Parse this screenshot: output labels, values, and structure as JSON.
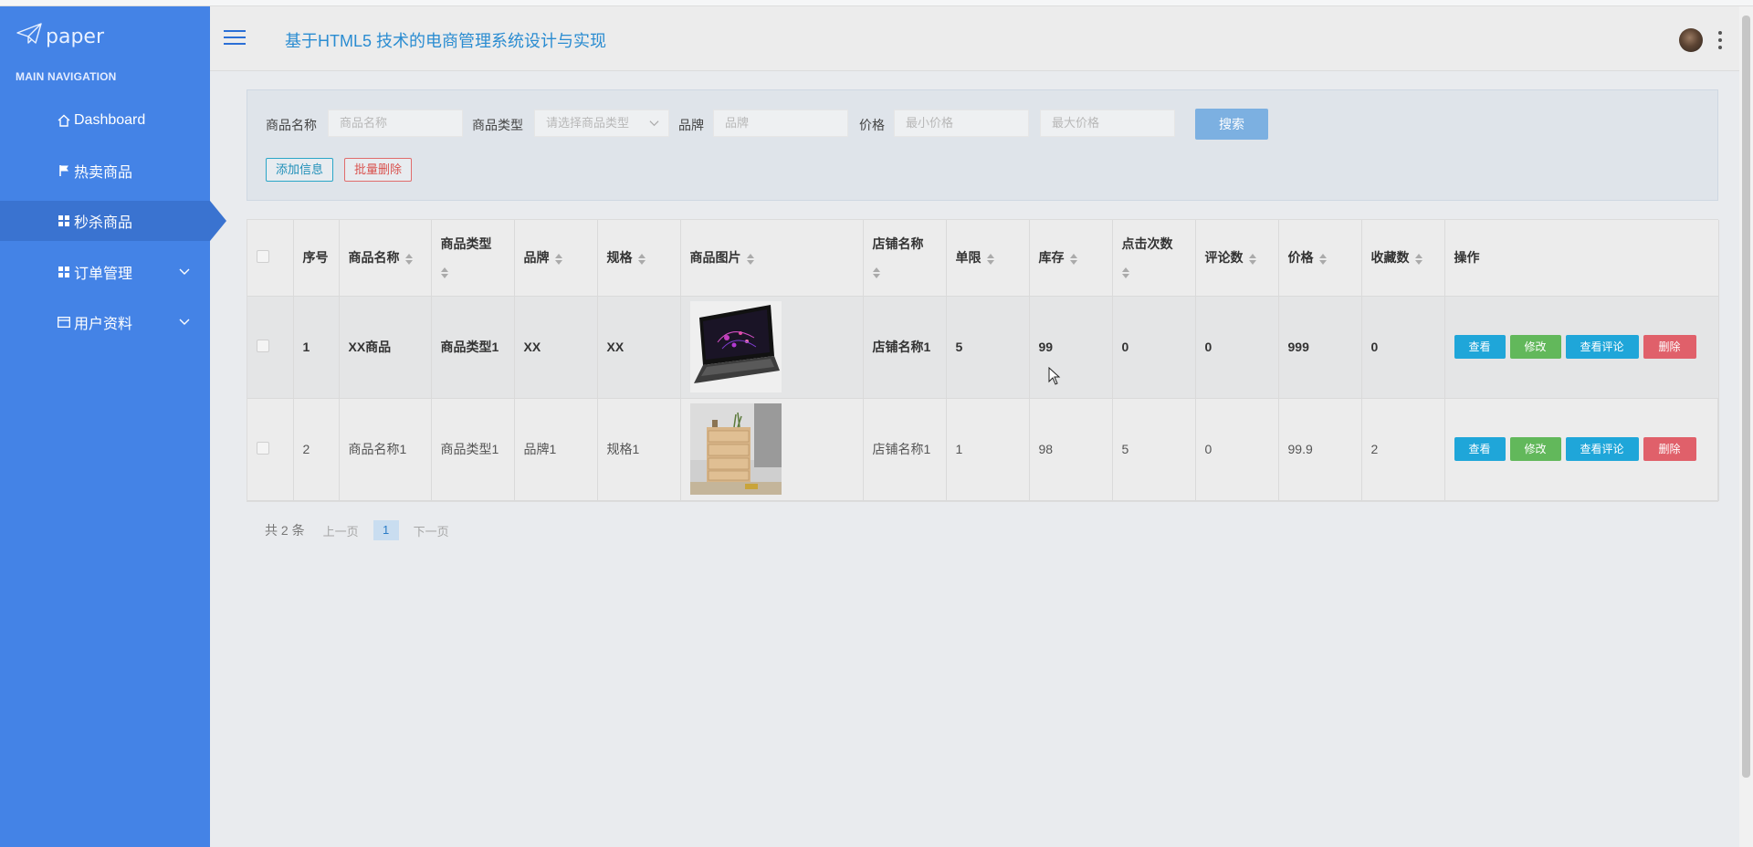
{
  "brand": {
    "name": "paper"
  },
  "sidebar": {
    "section_title": "MAIN NAVIGATION",
    "items": [
      {
        "label": "Dashboard",
        "icon": "home-icon"
      },
      {
        "label": "热卖商品",
        "icon": "flag-icon"
      },
      {
        "label": "秒杀商品",
        "icon": "grid-icon",
        "active": true
      },
      {
        "label": "订单管理",
        "icon": "grid-icon",
        "expandable": true
      },
      {
        "label": "用户资料",
        "icon": "card-icon",
        "expandable": true
      }
    ]
  },
  "header": {
    "title": "基于HTML5 技术的电商管理系统设计与实现"
  },
  "search": {
    "name_label": "商品名称",
    "name_placeholder": "商品名称",
    "type_label": "商品类型",
    "type_placeholder": "请选择商品类型",
    "brand_label": "品牌",
    "brand_placeholder": "品牌",
    "price_label": "价格",
    "min_price_placeholder": "最小价格",
    "max_price_placeholder": "最大价格",
    "search_button": "搜索",
    "add_button": "添加信息",
    "batch_delete_button": "批量删除"
  },
  "table": {
    "columns": [
      "序号",
      "商品名称",
      "商品类型",
      "品牌",
      "规格",
      "商品图片",
      "店铺名称",
      "单限",
      "库存",
      "点击次数",
      "评论数",
      "价格",
      "收藏数",
      "操作"
    ],
    "rows": [
      {
        "no": "1",
        "name": "XX商品",
        "type": "商品类型1",
        "brand": "XX",
        "spec": "XX",
        "image": "laptop",
        "shop": "店铺名称1",
        "limit": "5",
        "stock": "99",
        "clicks": "0",
        "comments": "0",
        "price": "999",
        "favorites": "0"
      },
      {
        "no": "2",
        "name": "商品名称1",
        "type": "商品类型1",
        "brand": "品牌1",
        "spec": "规格1",
        "image": "cabinet",
        "shop": "店铺名称1",
        "limit": "1",
        "stock": "98",
        "clicks": "5",
        "comments": "0",
        "price": "99.9",
        "favorites": "2"
      }
    ],
    "actions": {
      "view": "查看",
      "edit": "修改",
      "view_comments": "查看评论",
      "delete": "删除"
    }
  },
  "pagination": {
    "total": "共 2 条",
    "prev": "上一页",
    "current": "1",
    "next": "下一页"
  },
  "colors": {
    "sidebar": "#4483e6",
    "primary": "#1fa6d9",
    "success": "#62b85b",
    "danger": "#e0606a"
  }
}
